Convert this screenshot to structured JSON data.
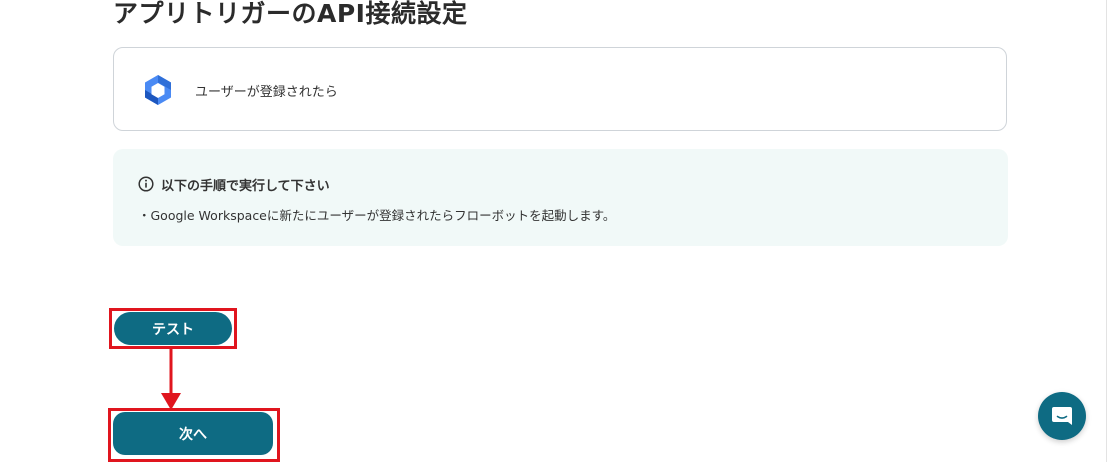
{
  "page": {
    "title": "アプリトリガーのAPI接続設定"
  },
  "trigger": {
    "app_icon": "google-workspace-icon",
    "label": "ユーザーが登録されたら"
  },
  "info": {
    "icon": "info-circle-icon",
    "heading": "以下の手順で実行して下さい",
    "text": "・Google Workspaceに新たにユーザーが登録されたらフローボットを起動します。"
  },
  "buttons": {
    "test_label": "テスト",
    "next_label": "次へ"
  },
  "chat": {
    "icon": "chat-bubble-icon"
  },
  "colors": {
    "primary": "#0e6b83",
    "highlight": "#e0151e",
    "info_background": "#f1f9f8"
  }
}
